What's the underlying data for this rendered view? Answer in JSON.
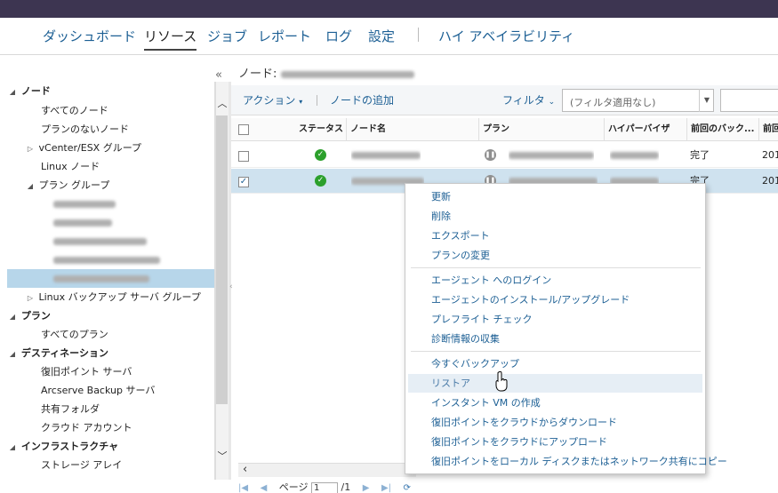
{
  "nav": {
    "items": [
      "ダッシュボード",
      "リソース",
      "ジョブ",
      "レポート",
      "ログ",
      "設定",
      "ハイ アベイラビリティ"
    ],
    "active": "リソース"
  },
  "breadcrumb": "ノード: ",
  "left_tree": {
    "nodes_header": "ノード",
    "all_nodes": "すべてのノード",
    "no_plan_nodes": "プランのないノード",
    "vcenter_group": "vCenter/ESX グループ",
    "linux_nodes": "Linux ノード",
    "plan_group": "プラン グループ",
    "linux_backup_group": "Linux バックアップ サーバ グループ",
    "plans_header": "プラン",
    "all_plans": "すべてのプラン",
    "destinations_header": "デスティネーション",
    "recovery_point_server": "復旧ポイント サーバ",
    "arcserve_backup_server": "Arcserve Backup サーバ",
    "shared_folder": "共有フォルダ",
    "cloud_account": "クラウド アカウント",
    "infrastructure_header": "インフラストラクチャ",
    "storage_array": "ストレージ アレイ"
  },
  "toolbar": {
    "action_label": "アクション",
    "add_node_label": "ノードの追加",
    "filter_label": "フィルタ",
    "filter_placeholder": "(フィルタ適用なし)"
  },
  "grid": {
    "columns": [
      "ステータス",
      "ノード名",
      "プラン",
      "ハイパーバイザ",
      "前回のバック...",
      "前回"
    ],
    "rows": [
      {
        "last_backup": "完了",
        "last_time": "201",
        "checked": false
      },
      {
        "last_backup": "完了",
        "last_time": "201",
        "checked": true
      }
    ]
  },
  "context_menu": {
    "group1": [
      "更新",
      "削除",
      "エクスポート",
      "プランの変更"
    ],
    "group2": [
      "エージェント へのログイン",
      "エージェントのインストール/アップグレード",
      "プレフライト チェック",
      "診断情報の収集"
    ],
    "group3": [
      "今すぐバックアップ",
      "リストア",
      "インスタント VM の作成",
      "復旧ポイントをクラウドからダウンロード",
      "復旧ポイントをクラウドにアップロード",
      "復旧ポイントをローカル ディスクまたはネットワーク共有にコピー"
    ],
    "hovered": "リストア"
  },
  "pager": {
    "page_label": "ページ",
    "page_value": "1",
    "total": "/1"
  },
  "colors": {
    "topbar": "#3d3551",
    "link": "#1c5f94",
    "selected_row": "#cfe2ef",
    "ok": "#2ca02c"
  }
}
